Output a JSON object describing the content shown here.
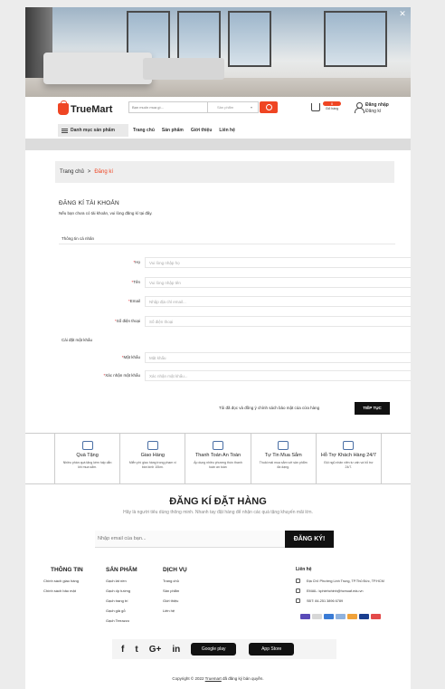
{
  "header": {
    "logo": "TrueMart",
    "search_placeholder": "Bạn muốn mua gì...",
    "search_category": "Sản phẩm",
    "cart_count": "0",
    "cart_label": "Giỏ hàng",
    "login": "Đăng nhập",
    "register": "Đăng kí"
  },
  "nav": {
    "categories": "Danh mục sản phẩm",
    "links": [
      "Trang chủ",
      "Sản phẩm",
      "Giới thiệu",
      "Liên hệ"
    ]
  },
  "breadcrumb": {
    "home": "Trang chủ",
    "separator": ">",
    "current": "Đăng kí"
  },
  "form": {
    "title": "ĐĂNG KÍ TÀI KHOẢN",
    "subtitle": "Nếu bạn chưa có tài khoản, vui lòng đăng kí tại đây.",
    "personal_section": "Thông tin cá nhân",
    "password_section": "Cài đặt mật khẩu",
    "fields": [
      {
        "label": "Họ",
        "placeholder": "Vui lòng nhập họ"
      },
      {
        "label": "Tên",
        "placeholder": "Vui lòng nhập tên"
      },
      {
        "label": "Email",
        "placeholder": "Nhập địa chỉ email..."
      },
      {
        "label": "Số điện thoại",
        "placeholder": "Số điện thoại"
      },
      {
        "label": "Mật khẩu",
        "placeholder": "Mật khẩu"
      },
      {
        "label": "Xác nhận mật khẩu",
        "placeholder": "Xác nhận mật khẩu..."
      }
    ],
    "required_mark": "*",
    "agree": "Tôi đã đọc và đồng ý chính sách bảo mật của cửa hàng",
    "submit": "TIẾP TỤC"
  },
  "features": [
    {
      "title": "Quà Tặng",
      "desc": "Nhiều phần quà tặng kèm hấp dẫn khi mua sắm."
    },
    {
      "title": "Giao Hàng",
      "desc": "Miễn phí giao hàng trong phạm vi bán kính 10km."
    },
    {
      "title": "Thanh Toán An Toàn",
      "desc": "Áp dụng nhiều phương thức thanh toán an toàn"
    },
    {
      "title": "Tự Tin Mua Sắm",
      "desc": "Thoải mái mua sắm với sản phẩm đa dạng."
    },
    {
      "title": "Hỗ Trợ Khách Hàng 24/7",
      "desc": "Đội ngũ nhân viên tư vấn và hỗ trợ 24/7."
    }
  ],
  "newsletter": {
    "title": "ĐĂNG KÍ ĐẶT HÀNG",
    "subtitle": "Hãy là người tiêu dùng thông minh. Nhanh tay đặt hàng để nhận các quà tặng khuyến mãi lớn.",
    "placeholder": "Nhập email của bạn...",
    "button": "ĐĂNG KÝ!"
  },
  "footer": {
    "info": {
      "title": "THÔNG TIN",
      "items": [
        "Chính sách giao hàng",
        "Chính sách bảo mật"
      ]
    },
    "products": {
      "title": "SẢN PHẨM",
      "items": [
        "Gạch lát nền",
        "Gạch ốp tường",
        "Gạch trang trí",
        "Gạch giả gỗ",
        "Gạch Terrazzo"
      ]
    },
    "services": {
      "title": "DỊCH VỤ",
      "items": [
        "Trang chủ",
        "Sản phẩm",
        "Giới thiệu",
        "Liên hệ"
      ]
    },
    "contact": {
      "title": "Liên hệ",
      "address": "Địa Chỉ: Phường Linh Trung, TP.Thủ Đức, TP.HCM",
      "email": "EMAIL: kphiehchinh@hcmuaf.edu.vn",
      "phone": "SĐT: 84-251 3896 6789"
    },
    "social": [
      "f",
      "t",
      "G+",
      "in"
    ],
    "google_play": "Google play",
    "app_store": "App Store",
    "copyright_pre": "Copyright © 2022",
    "copyright_brand": "Truemart",
    "copyright_post": "đã đăng ký bản quyền."
  },
  "colors": {
    "accent": "#ef4523",
    "dark": "#111111"
  }
}
